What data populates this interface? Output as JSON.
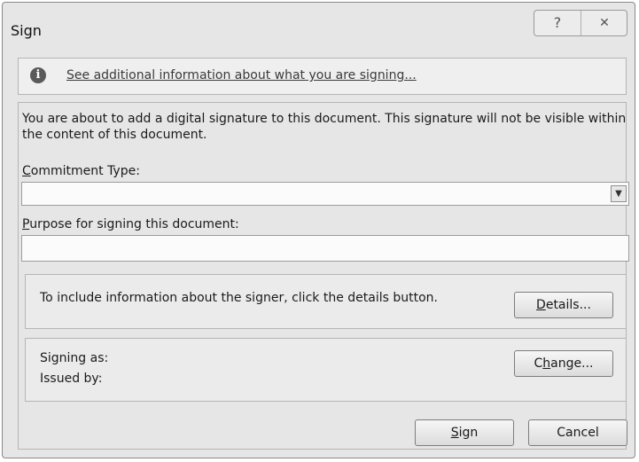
{
  "window": {
    "title": "Sign",
    "help_glyph": "?",
    "close_glyph": "✕"
  },
  "info": {
    "icon": "i",
    "link_text": "See additional information about what you are signing..."
  },
  "description": "You are about to add a digital signature to this document. This signature will not be visible within the content of this document.",
  "commitment": {
    "label_access": "C",
    "label_rest": "ommitment Type:",
    "value": "",
    "arrow": "▼"
  },
  "purpose": {
    "label_access": "P",
    "label_rest": "urpose for signing this document:",
    "value": ""
  },
  "details": {
    "text": "To include information about the signer, click the details button.",
    "button_access": "D",
    "button_rest": "etails..."
  },
  "signer": {
    "signing_as_label": "Signing as:",
    "issued_by_label": "Issued by:",
    "change_pre": "C",
    "change_access": "h",
    "change_post": "ange..."
  },
  "actions": {
    "sign_access": "S",
    "sign_rest": "ign",
    "cancel_label": "Cancel"
  }
}
